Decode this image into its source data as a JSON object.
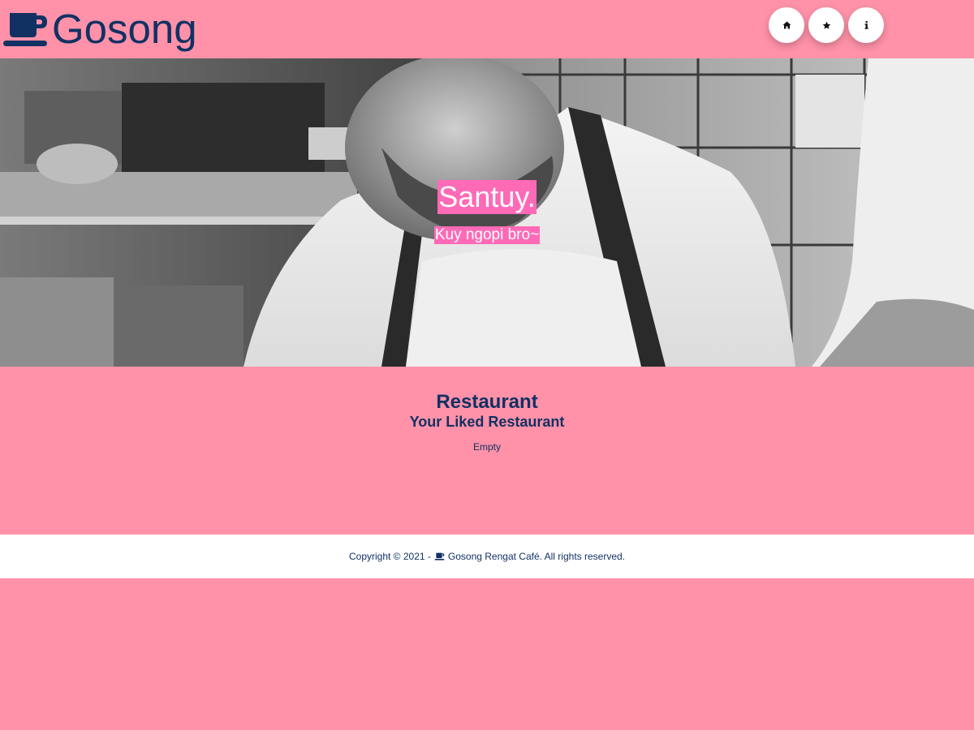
{
  "header": {
    "brand_icon": "coffee-cup-icon",
    "brand_name": "Gosong",
    "nav": [
      {
        "icon": "home-icon"
      },
      {
        "icon": "star-icon"
      },
      {
        "icon": "info-icon"
      }
    ]
  },
  "hero": {
    "title": "Santuy.",
    "tagline": "Kuy ngopi bro~",
    "image": "black-and-white photo of a chef in an apron working in a kitchen"
  },
  "main": {
    "title": "Restaurant",
    "subtitle": "Your Liked Restaurant",
    "empty_text": "Empty"
  },
  "footer": {
    "prefix": "Copyright © 2021 -",
    "icon": "coffee-cup-icon",
    "text": "Gosong Rengat Café. All rights reserved."
  },
  "colors": {
    "background": "#ff92a9",
    "brand_navy": "#123163",
    "highlight_pink": "#ff6ab7",
    "footer_bg": "#ffffff"
  }
}
